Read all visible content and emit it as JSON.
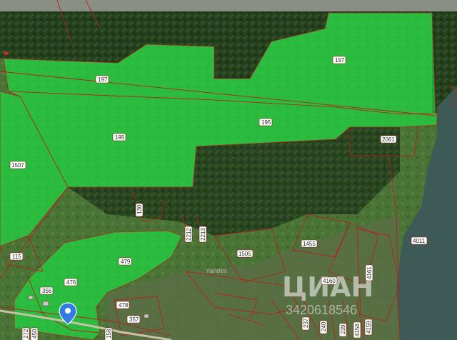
{
  "map": {
    "colors": {
      "forest": "#2b4a22",
      "field": "#4e7a3a",
      "highlight": "rgba(22,230,70,0.62)",
      "water": "#3e5a56",
      "boundary": "#b3241c",
      "marker": "#2f7de1"
    },
    "parcels": [
      {
        "id": "197a",
        "label": "197"
      },
      {
        "id": "197b",
        "label": "197"
      },
      {
        "id": "195a",
        "label": "195"
      },
      {
        "id": "195b",
        "label": "195"
      },
      {
        "id": "1507",
        "label": "1507"
      },
      {
        "id": "2061",
        "label": "2061"
      },
      {
        "id": "115",
        "label": "115"
      },
      {
        "id": "479",
        "label": "479"
      },
      {
        "id": "476",
        "label": "476"
      },
      {
        "id": "356",
        "label": "356"
      },
      {
        "id": "478",
        "label": "478"
      },
      {
        "id": "357",
        "label": "357"
      },
      {
        "id": "130",
        "label": "130"
      },
      {
        "id": "2212",
        "label": "2212"
      },
      {
        "id": "2213",
        "label": "2213"
      },
      {
        "id": "1505",
        "label": "1505"
      },
      {
        "id": "1455",
        "label": "1455"
      },
      {
        "id": "4160",
        "label": "4160"
      },
      {
        "id": "4161",
        "label": "4161"
      },
      {
        "id": "4011",
        "label": "4011"
      },
      {
        "id": "237",
        "label": "237"
      },
      {
        "id": "240",
        "label": "240"
      },
      {
        "id": "239",
        "label": "239"
      },
      {
        "id": "4158",
        "label": "4158"
      },
      {
        "id": "4159",
        "label": "4159"
      },
      {
        "id": "272",
        "label": "272"
      },
      {
        "id": "450",
        "label": "450"
      },
      {
        "id": "158",
        "label": "158"
      }
    ],
    "watermark": {
      "brand": "ЦИАН",
      "code": "3420618546",
      "yandex": "Yandex"
    },
    "marker": {
      "icon": "location-pin-icon"
    }
  }
}
